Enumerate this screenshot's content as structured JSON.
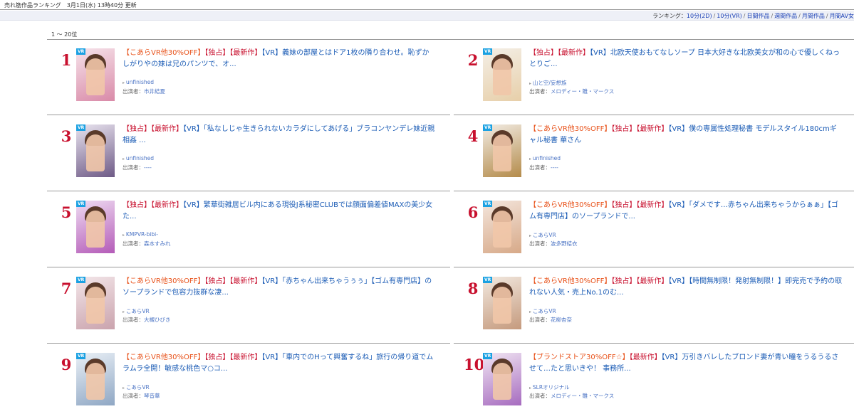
{
  "header": {
    "title": "売れ筋作品ランキング　3月1日(水) 13時40分 更新"
  },
  "subnav": {
    "prefix": "ランキング：",
    "links": [
      "10分(2D)",
      "10分(VR)",
      "日間作品",
      "週間作品",
      "月間作品",
      "月間AV女"
    ]
  },
  "range_label": "1 ～ 20位",
  "actress_prefix": "出演者：",
  "items": [
    {
      "rank": "1",
      "promo": "【こあらVR他30%OFF】",
      "tags": "【独占】【最新作】",
      "title": "【VR】義妹の部屋とはドア1枚の隣り合わせ。恥ずかしがりやの妹は兄のパンツで、オ...",
      "maker": "unfinished",
      "actress": "市井結夏"
    },
    {
      "rank": "2",
      "promo": "",
      "tags": "【独占】【最新作】",
      "title": "【VR】北欧天使おもてなしソープ 日本大好きな北欧美女が和の心で優しくねっとりご...",
      "maker": "山と空/妄想族",
      "actress": "メロディー・雛・マークス"
    },
    {
      "rank": "3",
      "promo": "",
      "tags": "【独占】【最新作】",
      "title": "【VR】「私なしじゃ生きられないカラダにしてあげる」ブラコンヤンデレ妹近親相姦 ...",
      "maker": "unfinished",
      "actress": "----"
    },
    {
      "rank": "4",
      "promo": "【こあらVR他30%OFF】",
      "tags": "【独占】【最新作】",
      "title": "【VR】僕の専属性処理秘書 モデルスタイル180cmギャル秘書 華さん",
      "maker": "unfinished",
      "actress": "----"
    },
    {
      "rank": "5",
      "promo": "",
      "tags": "【独占】【最新作】",
      "title": "【VR】繁華街雑居ビル内にある現役J系秘密CLUBでは顔面偏差値MAXの美少女た...",
      "maker": "KMPVR-bibi-",
      "actress": "森本すみれ"
    },
    {
      "rank": "6",
      "promo": "【こあらVR他30%OFF】",
      "tags": "【独占】【最新作】",
      "title": "【VR】「ダメです…赤ちゃん出来ちゃうからぁぁ」【ゴム有専門店】のソープランドで...",
      "maker": "こあらVR",
      "actress": "波多野結衣"
    },
    {
      "rank": "7",
      "promo": "【こあらVR他30%OFF】",
      "tags": "【独占】【最新作】",
      "title": "【VR】「赤ちゃん出来ちゃうぅぅ」【ゴム有専門店】のソープランドで包容力抜群な凄...",
      "maker": "こあらVR",
      "actress": "大槻ひびき"
    },
    {
      "rank": "8",
      "promo": "【こあらVR他30%OFF】",
      "tags": "【独占】【最新作】",
      "title": "【VR】【時間無制限！発射無制限！】即完売で予約の取れない人気・売上No.1のむ...",
      "maker": "こあらVR",
      "actress": "花柳杏奈"
    },
    {
      "rank": "9",
      "promo": "【こあらVR他30%OFF】",
      "tags": "【独占】【最新作】",
      "title": "【VR】「車内でのHって興奮するね」旅行の帰り道でムラムラ全開！敏感な桃色マ○コ...",
      "maker": "こあらVR",
      "actress": "琴音華"
    },
    {
      "rank": "10",
      "promo": "【ブランドストア30%OFF☆】",
      "tags": "【最新作】",
      "title": "【VR】万引きバレしたブロンド妻が青い瞳をうるうるさせて…たと思いきや！ 事務所...",
      "maker": "SLRオリジナル",
      "actress": "メロディー・雛・マークス"
    }
  ],
  "colors": {
    "rank": "#c8102e",
    "promo": "#e8521a",
    "link": "#1a5bb5",
    "subnav_bg": "#eef0f7"
  }
}
